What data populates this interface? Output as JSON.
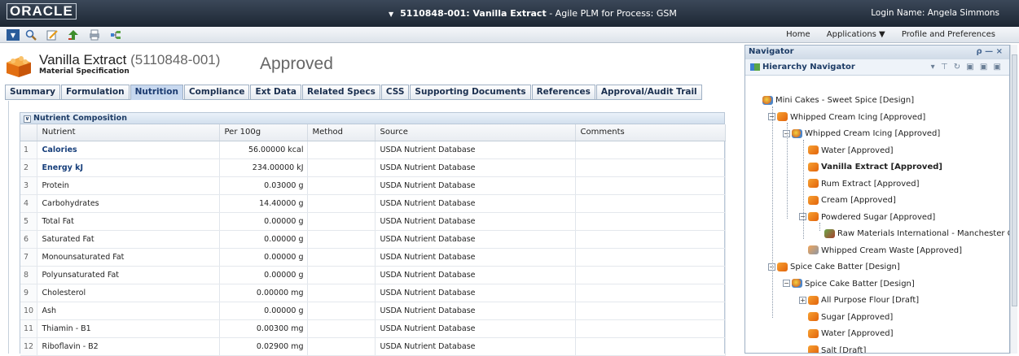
{
  "app": {
    "logo": "ORACLE",
    "title": "5110848-001: Vanilla Extract",
    "title_suffix": " - Agile PLM for Process: GSM",
    "login": "Login Name: Angela Simmons"
  },
  "topnav": {
    "home": "Home",
    "applications": "Applications ▼",
    "profile": "Profile and Preferences"
  },
  "toolbar": {
    "icons": [
      "menu-icon",
      "search-icon",
      "edit-icon",
      "upload-icon",
      "print-icon",
      "hierarchy-icon"
    ]
  },
  "header": {
    "name": "Vanilla Extract",
    "number": "(5110848-001)",
    "type": "Material Specification",
    "status": "Approved"
  },
  "tabs": [
    "Summary",
    "Formulation",
    "Nutrition",
    "Compliance",
    "Ext Data",
    "Related Specs",
    "CSS",
    "Supporting Documents",
    "References",
    "Approval/Audit Trail"
  ],
  "active_tab": "Nutrition",
  "section": {
    "title": "Nutrient Composition",
    "columns": [
      "Nutrient",
      "Per 100g",
      "Method",
      "Source",
      "Comments"
    ],
    "rows": [
      {
        "n": "1",
        "nutrient": "Calories",
        "per100": "56.00000 kcal",
        "method": "",
        "source": "USDA Nutrient Database",
        "comments": ""
      },
      {
        "n": "2",
        "nutrient": "Energy kJ",
        "per100": "234.00000 kJ",
        "method": "",
        "source": "USDA Nutrient Database",
        "comments": ""
      },
      {
        "n": "3",
        "nutrient": "Protein",
        "per100": "0.03000 g",
        "method": "",
        "source": "USDA Nutrient Database",
        "comments": ""
      },
      {
        "n": "4",
        "nutrient": "Carbohydrates",
        "per100": "14.40000 g",
        "method": "",
        "source": "USDA Nutrient Database",
        "comments": ""
      },
      {
        "n": "5",
        "nutrient": "Total Fat",
        "per100": "0.00000 g",
        "method": "",
        "source": "USDA Nutrient Database",
        "comments": ""
      },
      {
        "n": "6",
        "nutrient": "Saturated Fat",
        "per100": "0.00000 g",
        "method": "",
        "source": "USDA Nutrient Database",
        "comments": ""
      },
      {
        "n": "7",
        "nutrient": "Monounsaturated Fat",
        "per100": "0.00000 g",
        "method": "",
        "source": "USDA Nutrient Database",
        "comments": ""
      },
      {
        "n": "8",
        "nutrient": "Polyunsaturated Fat",
        "per100": "0.00000 g",
        "method": "",
        "source": "USDA Nutrient Database",
        "comments": ""
      },
      {
        "n": "9",
        "nutrient": "Cholesterol",
        "per100": "0.00000 mg",
        "method": "",
        "source": "USDA Nutrient Database",
        "comments": ""
      },
      {
        "n": "10",
        "nutrient": "Ash",
        "per100": "0.00000 g",
        "method": "",
        "source": "USDA Nutrient Database",
        "comments": ""
      },
      {
        "n": "11",
        "nutrient": "Thiamin - B1",
        "per100": "0.00300 mg",
        "method": "",
        "source": "USDA Nutrient Database",
        "comments": ""
      },
      {
        "n": "12",
        "nutrient": "Riboflavin - B2",
        "per100": "0.02900 mg",
        "method": "",
        "source": "USDA Nutrient Database",
        "comments": ""
      }
    ]
  },
  "navigator": {
    "title": "Navigator",
    "controls": "ρ — ×",
    "hierarchy_title": "Hierarchy Navigator",
    "tree": [
      {
        "label": "Mini Cakes - Sweet Spice [Design]",
        "icon": "formulation-icon"
      },
      {
        "label": "Whipped Cream Icing [Approved]",
        "icon": "material-icon"
      },
      {
        "label": "Whipped Cream Icing [Approved]",
        "icon": "formulation-icon"
      },
      {
        "label": "Water [Approved]",
        "icon": "material-icon"
      },
      {
        "label": "Vanilla Extract [Approved]",
        "icon": "material-icon"
      },
      {
        "label": "Rum Extract [Approved]",
        "icon": "material-icon"
      },
      {
        "label": "Cream [Approved]",
        "icon": "material-icon"
      },
      {
        "label": "Powdered Sugar [Approved]",
        "icon": "material-icon"
      },
      {
        "label": "Raw Materials International - Manchester Cente",
        "icon": "supplier-icon"
      },
      {
        "label": "Whipped Cream Waste [Approved]",
        "icon": "waste-icon"
      },
      {
        "label": "Spice Cake Batter [Design]",
        "icon": "material-icon"
      },
      {
        "label": "Spice Cake Batter [Design]",
        "icon": "formulation-icon"
      },
      {
        "label": "All Purpose Flour [Draft]",
        "icon": "material-icon"
      },
      {
        "label": "Sugar [Approved]",
        "icon": "material-icon"
      },
      {
        "label": "Water [Approved]",
        "icon": "material-icon"
      },
      {
        "label": "Salt [Draft]",
        "icon": "material-icon"
      }
    ]
  }
}
